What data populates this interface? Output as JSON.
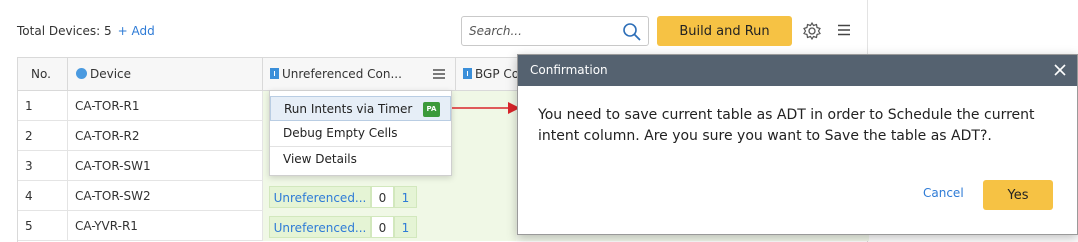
{
  "toolbar": {
    "total_devices": "Total Devices: 5",
    "add_label": "+ Add",
    "search_placeholder": "Search...",
    "build_run_label": "Build and Run"
  },
  "grid": {
    "headers": {
      "no": "No.",
      "device": "Device",
      "unref": "Unreferenced Con...",
      "bgp": "BGP Co"
    },
    "rows": [
      {
        "no": "1",
        "device": "CA-TOR-R1"
      },
      {
        "no": "2",
        "device": "CA-TOR-R2"
      },
      {
        "no": "3",
        "device": "CA-TOR-SW1"
      },
      {
        "no": "4",
        "device": "CA-TOR-SW2",
        "unref_label": "Unreferenced...",
        "n0": "0",
        "n1": "1"
      },
      {
        "no": "5",
        "device": "CA-YVR-R1",
        "unref_label": "Unreferenced...",
        "n0": "0",
        "n1": "1"
      }
    ]
  },
  "context_menu": {
    "items": [
      "Run Intents via Timer",
      "Debug Empty Cells",
      "View Details"
    ],
    "pa_badge": "PA"
  },
  "dialog": {
    "title": "Confirmation",
    "message": "You need to save current table as ADT in order to Schedule the current intent column. Are you sure you want to Save the table as ADT?.",
    "cancel_label": "Cancel",
    "yes_label": "Yes"
  },
  "colors": {
    "accent": "#f6c244",
    "link": "#2e7bd6",
    "dialog_header": "#556270",
    "arrow": "#d9252a"
  }
}
